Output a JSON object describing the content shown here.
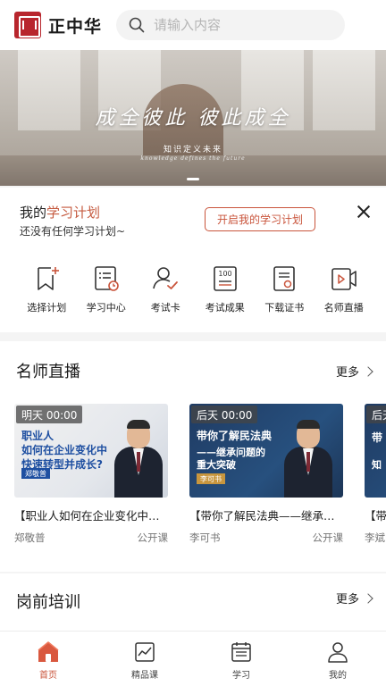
{
  "header": {
    "brand": "正中华",
    "search_placeholder": "请输入内容"
  },
  "banner": {
    "slogan": "成全彼此 彼此成全",
    "subtitle": "知识定义未来",
    "subtitle_en": "knowledge defines the future"
  },
  "plan": {
    "title_prefix": "我的",
    "title_highlight": "学习计划",
    "status": "还没有任何学习计划~",
    "button": "开启我的学习计划"
  },
  "quick_menu": [
    {
      "label": "选择计划",
      "icon": "bookmark-plus-icon"
    },
    {
      "label": "学习中心",
      "icon": "list-clock-icon"
    },
    {
      "label": "考试卡",
      "icon": "user-check-icon"
    },
    {
      "label": "考试成果",
      "icon": "score-100-icon"
    },
    {
      "label": "下载证书",
      "icon": "certificate-icon"
    },
    {
      "label": "名师直播",
      "icon": "video-play-icon"
    }
  ],
  "live": {
    "title": "名师直播",
    "more": "更多",
    "cards": [
      {
        "badge": "明天 00:00",
        "thumb_line1": "职业人",
        "thumb_line2": "如何在企业变化中",
        "thumb_line3": "快速转型并成长?",
        "thumb_name": "郑敬普",
        "title": "【职业人如何在企业变化中快速转型并成长?】",
        "teacher": "郑敬普",
        "type": "公开课"
      },
      {
        "badge": "后天 00:00",
        "thumb_line1": "带你了解民法典",
        "thumb_line2": "——继承问题的",
        "thumb_line3": "重大突破",
        "thumb_name": "李可书",
        "title": "【带你了解民法典——继承问题的重大突破】",
        "teacher": "李可书",
        "type": "公开课"
      },
      {
        "badge": "后天",
        "thumb_line1": "带",
        "thumb_line2": "知",
        "thumb_line3": "",
        "thumb_name": "",
        "title": "【带",
        "teacher": "李斌",
        "type": ""
      }
    ]
  },
  "training": {
    "title": "岗前培训",
    "more": "更多"
  },
  "tabbar": [
    {
      "label": "首页",
      "icon": "home-icon",
      "active": true
    },
    {
      "label": "精品课",
      "icon": "chart-card-icon",
      "active": false
    },
    {
      "label": "学习",
      "icon": "calendar-list-icon",
      "active": false
    },
    {
      "label": "我的",
      "icon": "person-icon",
      "active": false
    }
  ],
  "colors": {
    "accent": "#c9543b",
    "brand_red": "#b8262d"
  }
}
